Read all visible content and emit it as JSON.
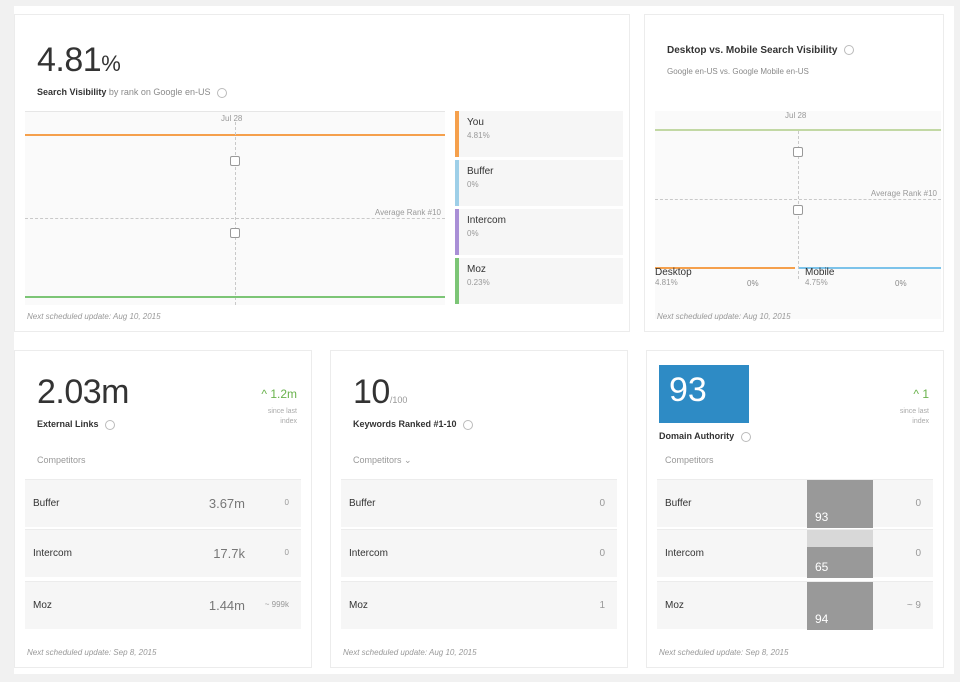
{
  "search_visibility": {
    "value": "4.81",
    "unit": "%",
    "label": "Search Visibility",
    "sublabel": "by rank on Google en-US",
    "date_label": "Jul 28",
    "avg_rank_label": "Average Rank #10",
    "legend": [
      {
        "name": "You",
        "value": "4.81%",
        "color": "#f5a04c"
      },
      {
        "name": "Buffer",
        "value": "0%",
        "color": "#9ecfe8"
      },
      {
        "name": "Intercom",
        "value": "0%",
        "color": "#a98fd6"
      },
      {
        "name": "Moz",
        "value": "0.23%",
        "color": "#7cc576"
      }
    ],
    "footer": "Next scheduled update: Aug 10, 2015"
  },
  "desktop_mobile": {
    "title": "Desktop vs. Mobile Search Visibility",
    "subtitle": "Google en-US vs. Google Mobile en-US",
    "date_label": "Jul 28",
    "avg_rank_label": "Average Rank #10",
    "desktop": {
      "label": "Desktop",
      "value": "4.81%",
      "change": "0%",
      "color": "#f5a04c"
    },
    "mobile": {
      "label": "Mobile",
      "value": "4.75%",
      "change": "0%",
      "color": "#7cc3ea"
    },
    "footer": "Next scheduled update: Aug 10, 2015"
  },
  "external_links": {
    "value": "2.03m",
    "label": "External Links",
    "delta": "1.2m",
    "delta_note_1": "since last",
    "delta_note_2": "index",
    "competitors_label": "Competitors",
    "rows": [
      {
        "name": "Buffer",
        "value": "3.67m",
        "change": "0"
      },
      {
        "name": "Intercom",
        "value": "17.7k",
        "change": "0"
      },
      {
        "name": "Moz",
        "value": "1.44m",
        "change": "~ 999k"
      }
    ],
    "footer": "Next scheduled update: Sep 8, 2015"
  },
  "keywords": {
    "value": "10",
    "unit": "/100",
    "label": "Keywords Ranked #1-10",
    "competitors_label": "Competitors",
    "rows": [
      {
        "name": "Buffer",
        "value": "0"
      },
      {
        "name": "Intercom",
        "value": "0"
      },
      {
        "name": "Moz",
        "value": "1"
      }
    ],
    "footer": "Next scheduled update: Aug 10, 2015"
  },
  "domain_authority": {
    "value": "93",
    "label": "Domain Authority",
    "delta": "1",
    "delta_note_1": "since last",
    "delta_note_2": "index",
    "competitors_label": "Competitors",
    "rows": [
      {
        "name": "Buffer",
        "score": "93",
        "change": "0"
      },
      {
        "name": "Intercom",
        "score": "65",
        "change": "0"
      },
      {
        "name": "Moz",
        "score": "94",
        "change": "~ 9"
      }
    ],
    "footer": "Next scheduled update: Sep 8, 2015"
  }
}
